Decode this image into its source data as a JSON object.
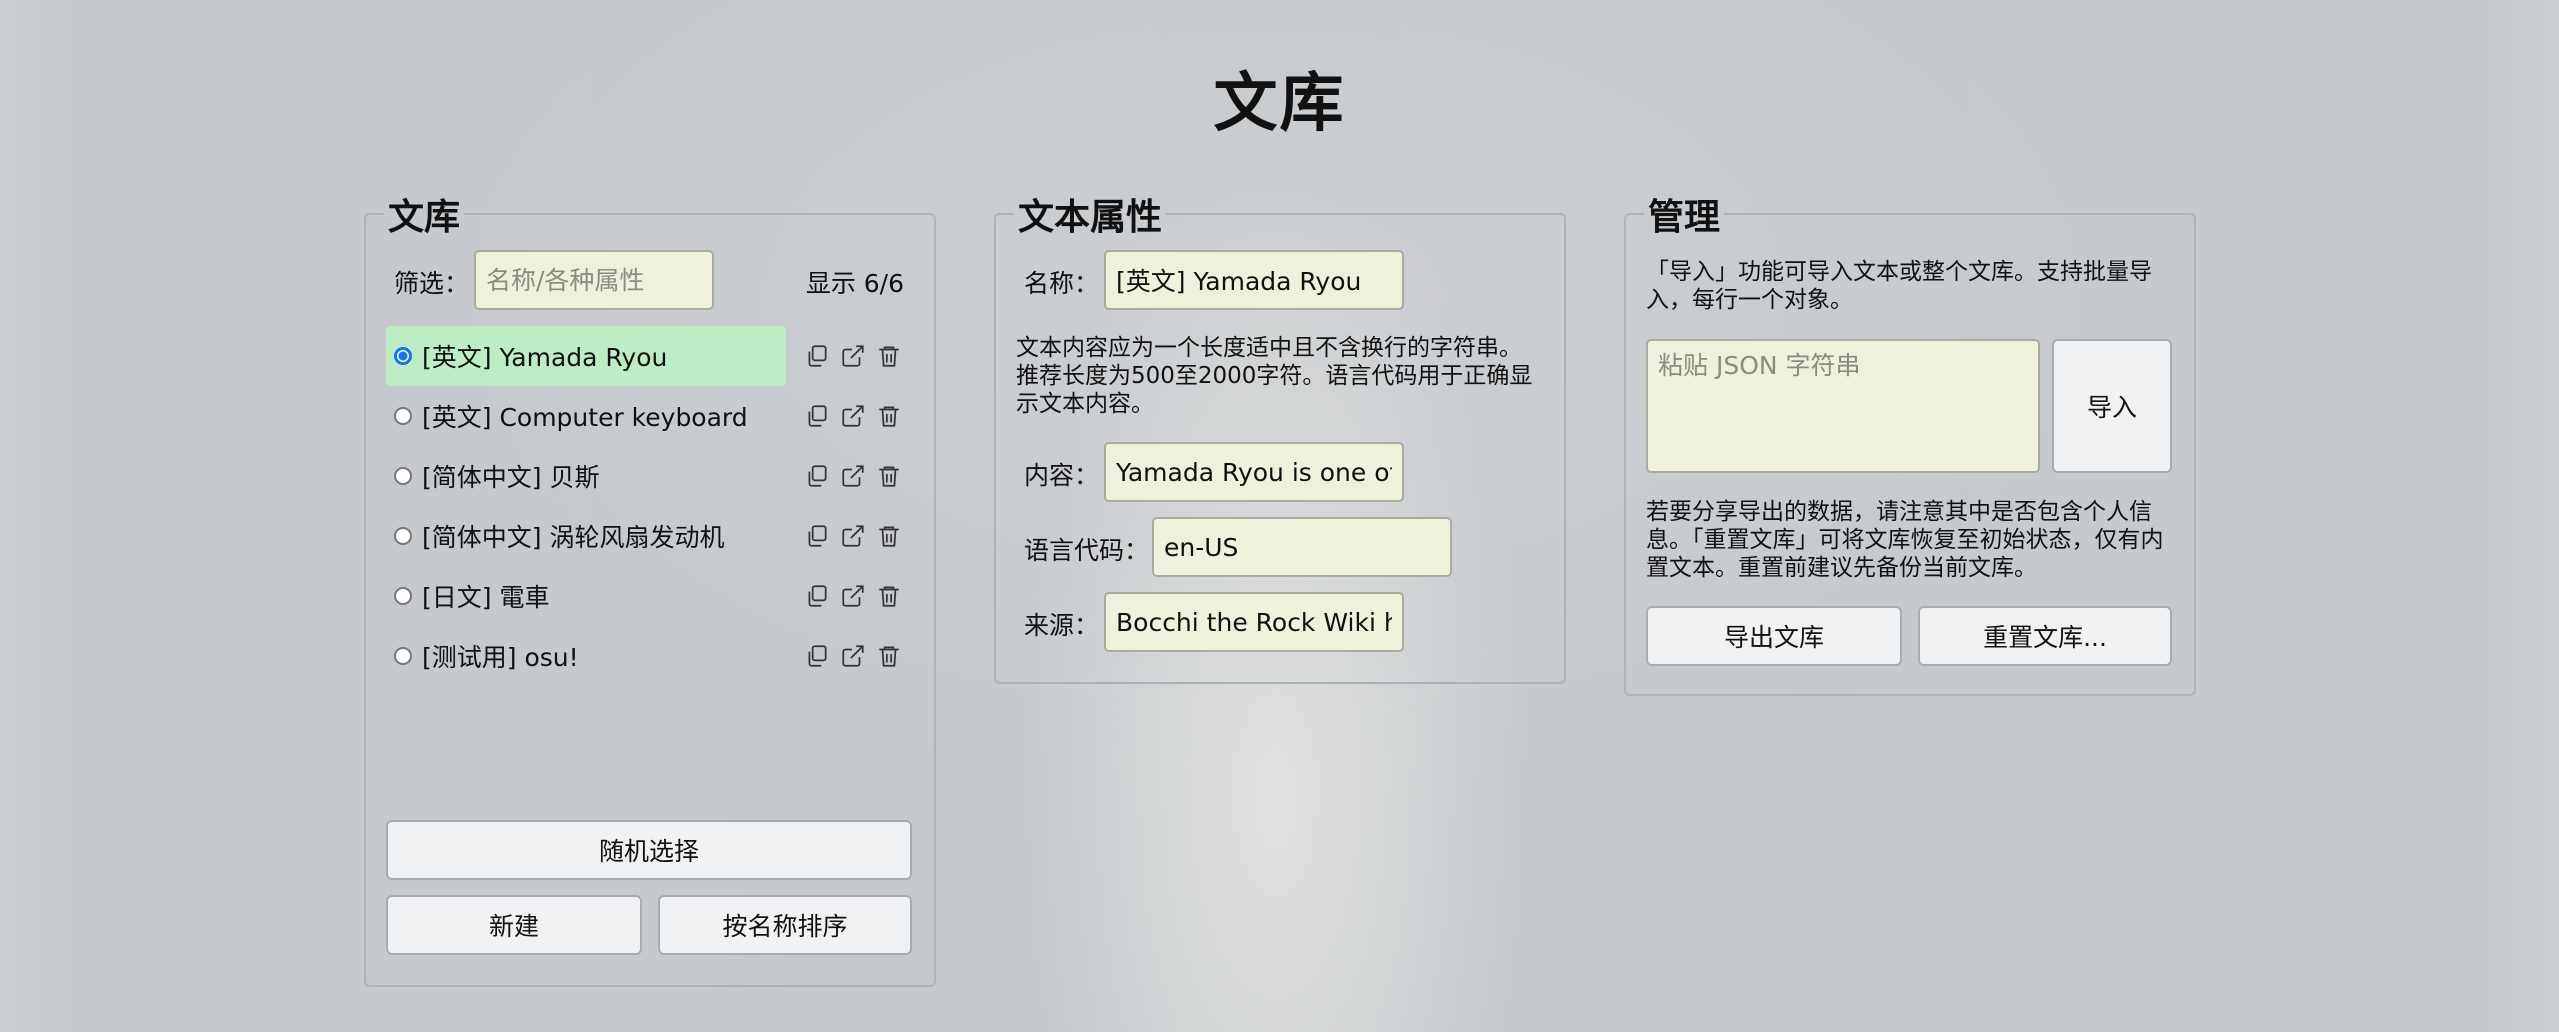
{
  "page": {
    "title": "文库"
  },
  "library": {
    "legend": "文库",
    "filter_label": "筛选：",
    "filter_placeholder": "名称/各种属性",
    "count_text": "显示 6/6",
    "items": [
      {
        "label": "[英文] Yamada Ryou",
        "selected": true
      },
      {
        "label": "[英文] Computer keyboard",
        "selected": false
      },
      {
        "label": "[简体中文] 贝斯",
        "selected": false
      },
      {
        "label": "[简体中文] 涡轮风扇发动机",
        "selected": false
      },
      {
        "label": "[日文] 電車",
        "selected": false
      },
      {
        "label": "[测试用] osu!",
        "selected": false
      }
    ],
    "random_button": "随机选择",
    "new_button": "新建",
    "sort_button": "按名称排序"
  },
  "properties": {
    "legend": "文本属性",
    "name_label": "名称：",
    "name_value": "[英文] Yamada Ryou",
    "hint": "文本内容应为一个长度适中且不含换行的字符串。推荐长度为500至2000字符。语言代码用于正确显示文本内容。",
    "content_label": "内容：",
    "content_value": "Yamada Ryou is one of th",
    "lang_label": "语言代码：",
    "lang_value": "en-US",
    "source_label": "来源：",
    "source_value": "Bocchi the Rock Wiki http"
  },
  "manage": {
    "legend": "管理",
    "import_hint": "「导入」功能可导入文本或整个文库。支持批量导入，每行一个对象。",
    "json_placeholder": "粘贴 JSON 字符串",
    "import_button": "导入",
    "share_hint": "若要分享导出的数据，请注意其中是否包含个人信息。「重置文库」可将文库恢复至初始状态，仅有内置文本。重置前建议先备份当前文库。",
    "export_button": "导出文库",
    "reset_button": "重置文库..."
  },
  "colors": {
    "selected_row": "#bdedc4",
    "input_bg": "#eff1dc",
    "radio_accent": "#1a73e8"
  },
  "icons": [
    "copy-icon",
    "external-link-icon",
    "trash-icon"
  ]
}
